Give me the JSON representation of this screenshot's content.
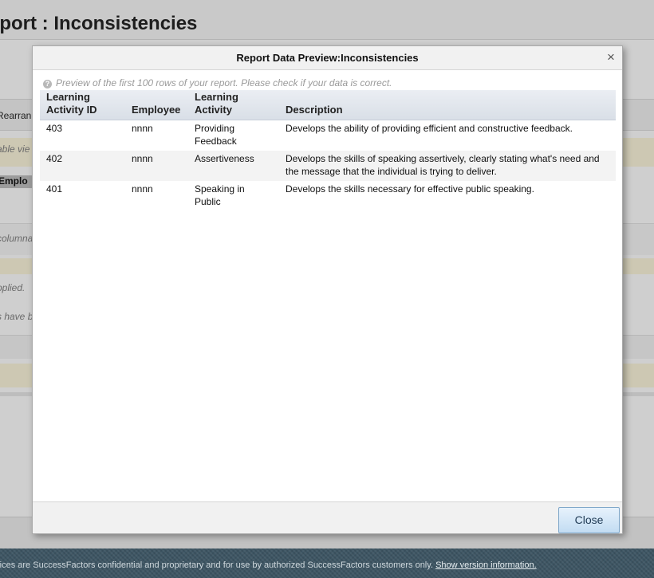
{
  "background": {
    "title": "eport : Inconsistencies",
    "fragments": [
      "Rearran",
      "able vie",
      "Emplo",
      "columna",
      "pplied.",
      "s have b"
    ]
  },
  "dialog": {
    "title": "Report Data Preview:Inconsistencies",
    "close_symbol": "×",
    "hint": "Preview of the first 100 rows of your report. Please check if your data is correct.",
    "close_button": "Close"
  },
  "table": {
    "headers": [
      "Learning Activity ID",
      "Employee",
      "Learning Activity",
      "Description"
    ],
    "rows": [
      [
        "403",
        "nnnn",
        "Providing Feedback",
        "Develops the ability of providing efficient and constructive feedback."
      ],
      [
        "402",
        "nnnn",
        "Assertiveness",
        "Develops the skills of speaking assertively, clearly stating what's need and the message that the individual is trying to deliver."
      ],
      [
        "401",
        "nnnn",
        "Speaking in Public",
        "Develops the skills necessary for effective public speaking."
      ]
    ]
  },
  "footer": {
    "text": "rices are SuccessFactors confidential and proprietary and for use by authorized SuccessFactors customers only.",
    "link": "Show version information."
  },
  "colors": {
    "overlay_bg": "#cfcfcf",
    "header_gradient_top": "#ebeef3",
    "footer_bg": "#3d5563",
    "button_border": "#7fa7c9"
  }
}
